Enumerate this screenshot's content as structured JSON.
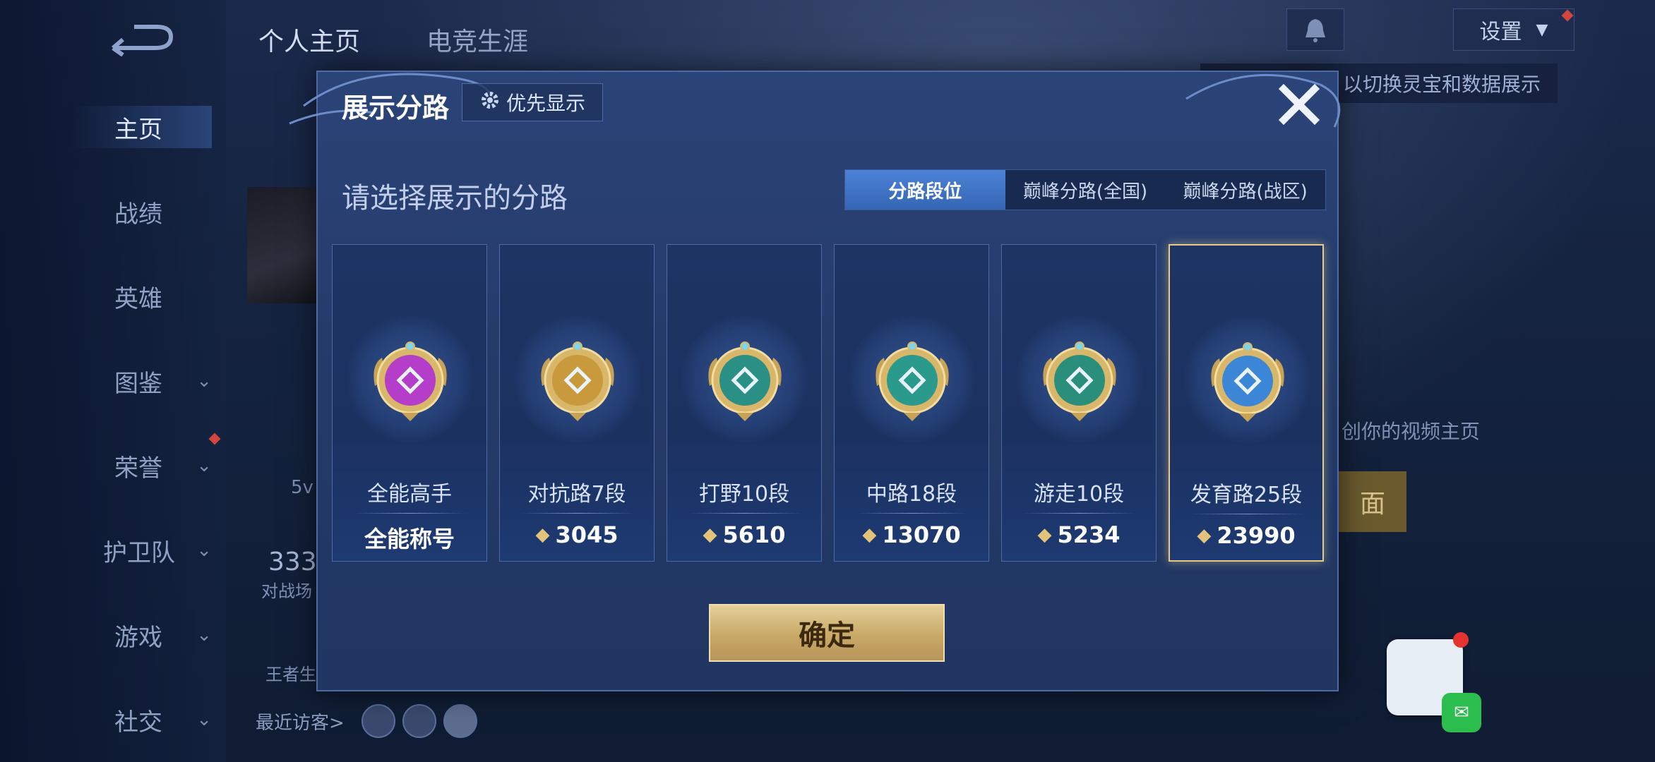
{
  "nav": {
    "top_tabs": [
      "个人主页",
      "电竞生涯"
    ],
    "settings_label": "设置",
    "sidebar": [
      {
        "label": "主页",
        "active": true
      },
      {
        "label": "战绩"
      },
      {
        "label": "英雄"
      },
      {
        "label": "图鉴",
        "chevron": true
      },
      {
        "label": "荣誉",
        "chevron": true
      },
      {
        "label": "护卫队",
        "chevron": true
      },
      {
        "label": "游戏",
        "chevron": true
      },
      {
        "label": "社交",
        "chevron": true
      }
    ]
  },
  "background": {
    "tip": "以切换灵宝和数据展示",
    "video_tip": "创你的视频主页",
    "video_btn": "面",
    "mode": "5v",
    "count": "333",
    "count_label": "对战场",
    "brand": "王者生",
    "visitors_label": "最近访客>"
  },
  "modal": {
    "title": "展示分路",
    "priority_label": "优先显示",
    "subtitle": "请选择展示的分路",
    "tabs": [
      {
        "label": "分路段位",
        "active": true
      },
      {
        "label": "巅峰分路(全国)"
      },
      {
        "label": "巅峰分路(战区)"
      }
    ],
    "cards": [
      {
        "name": "全能高手",
        "score": "全能称号",
        "badge": "all-round-badge-icon",
        "color": "#b43ec9"
      },
      {
        "name": "对抗路7段",
        "score": "3045",
        "badge": "clash-lane-badge-icon",
        "color": "#c99a3c"
      },
      {
        "name": "打野10段",
        "score": "5610",
        "badge": "jungle-badge-icon",
        "color": "#2a8f84"
      },
      {
        "name": "中路18段",
        "score": "13070",
        "badge": "mid-lane-badge-icon",
        "color": "#2a9a8c"
      },
      {
        "name": "游走10段",
        "score": "5234",
        "badge": "roam-badge-icon",
        "color": "#2a8f7a"
      },
      {
        "name": "发育路25段",
        "score": "23990",
        "badge": "farm-lane-badge-icon",
        "color": "#3b86d6",
        "selected": true
      }
    ],
    "confirm_label": "确定"
  }
}
